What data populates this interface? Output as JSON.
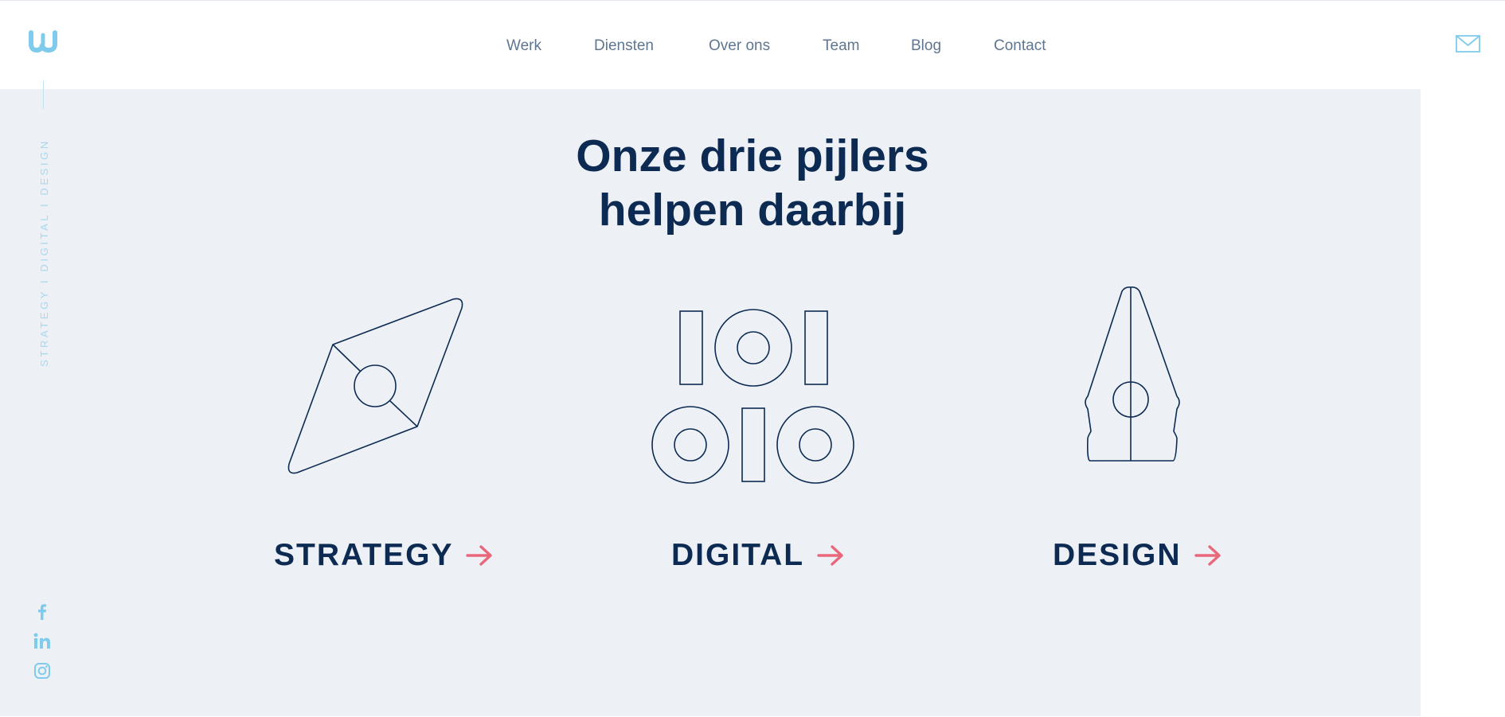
{
  "brand": {
    "logo_icon": "w-logo-icon",
    "accent_color": "#7fcbeb"
  },
  "nav": {
    "items": [
      {
        "label": "Werk"
      },
      {
        "label": "Diensten"
      },
      {
        "label": "Over ons"
      },
      {
        "label": "Team"
      },
      {
        "label": "Blog"
      },
      {
        "label": "Contact"
      }
    ],
    "text_color": "#5f7691"
  },
  "header_actions": {
    "mail_icon": "envelope-icon"
  },
  "sidebar": {
    "tagline": "STRATEGY I DIGITAL I DESIGN",
    "socials": [
      {
        "icon": "facebook-icon"
      },
      {
        "icon": "linkedin-icon"
      },
      {
        "icon": "instagram-icon"
      }
    ]
  },
  "hero": {
    "heading_line1": "Onze drie pijlers",
    "heading_line2": "helpen daarbij",
    "background": "#edf1f6",
    "heading_color": "#0d2b52"
  },
  "pillars": [
    {
      "label": "STRATEGY",
      "icon": "compass-icon",
      "arrow_icon": "arrow-right-icon"
    },
    {
      "label": "DIGITAL",
      "icon": "binary-digits-icon",
      "arrow_icon": "arrow-right-icon"
    },
    {
      "label": "DESIGN",
      "icon": "pen-nib-icon",
      "arrow_icon": "arrow-right-icon"
    }
  ],
  "arrow_color": "#e8677b"
}
